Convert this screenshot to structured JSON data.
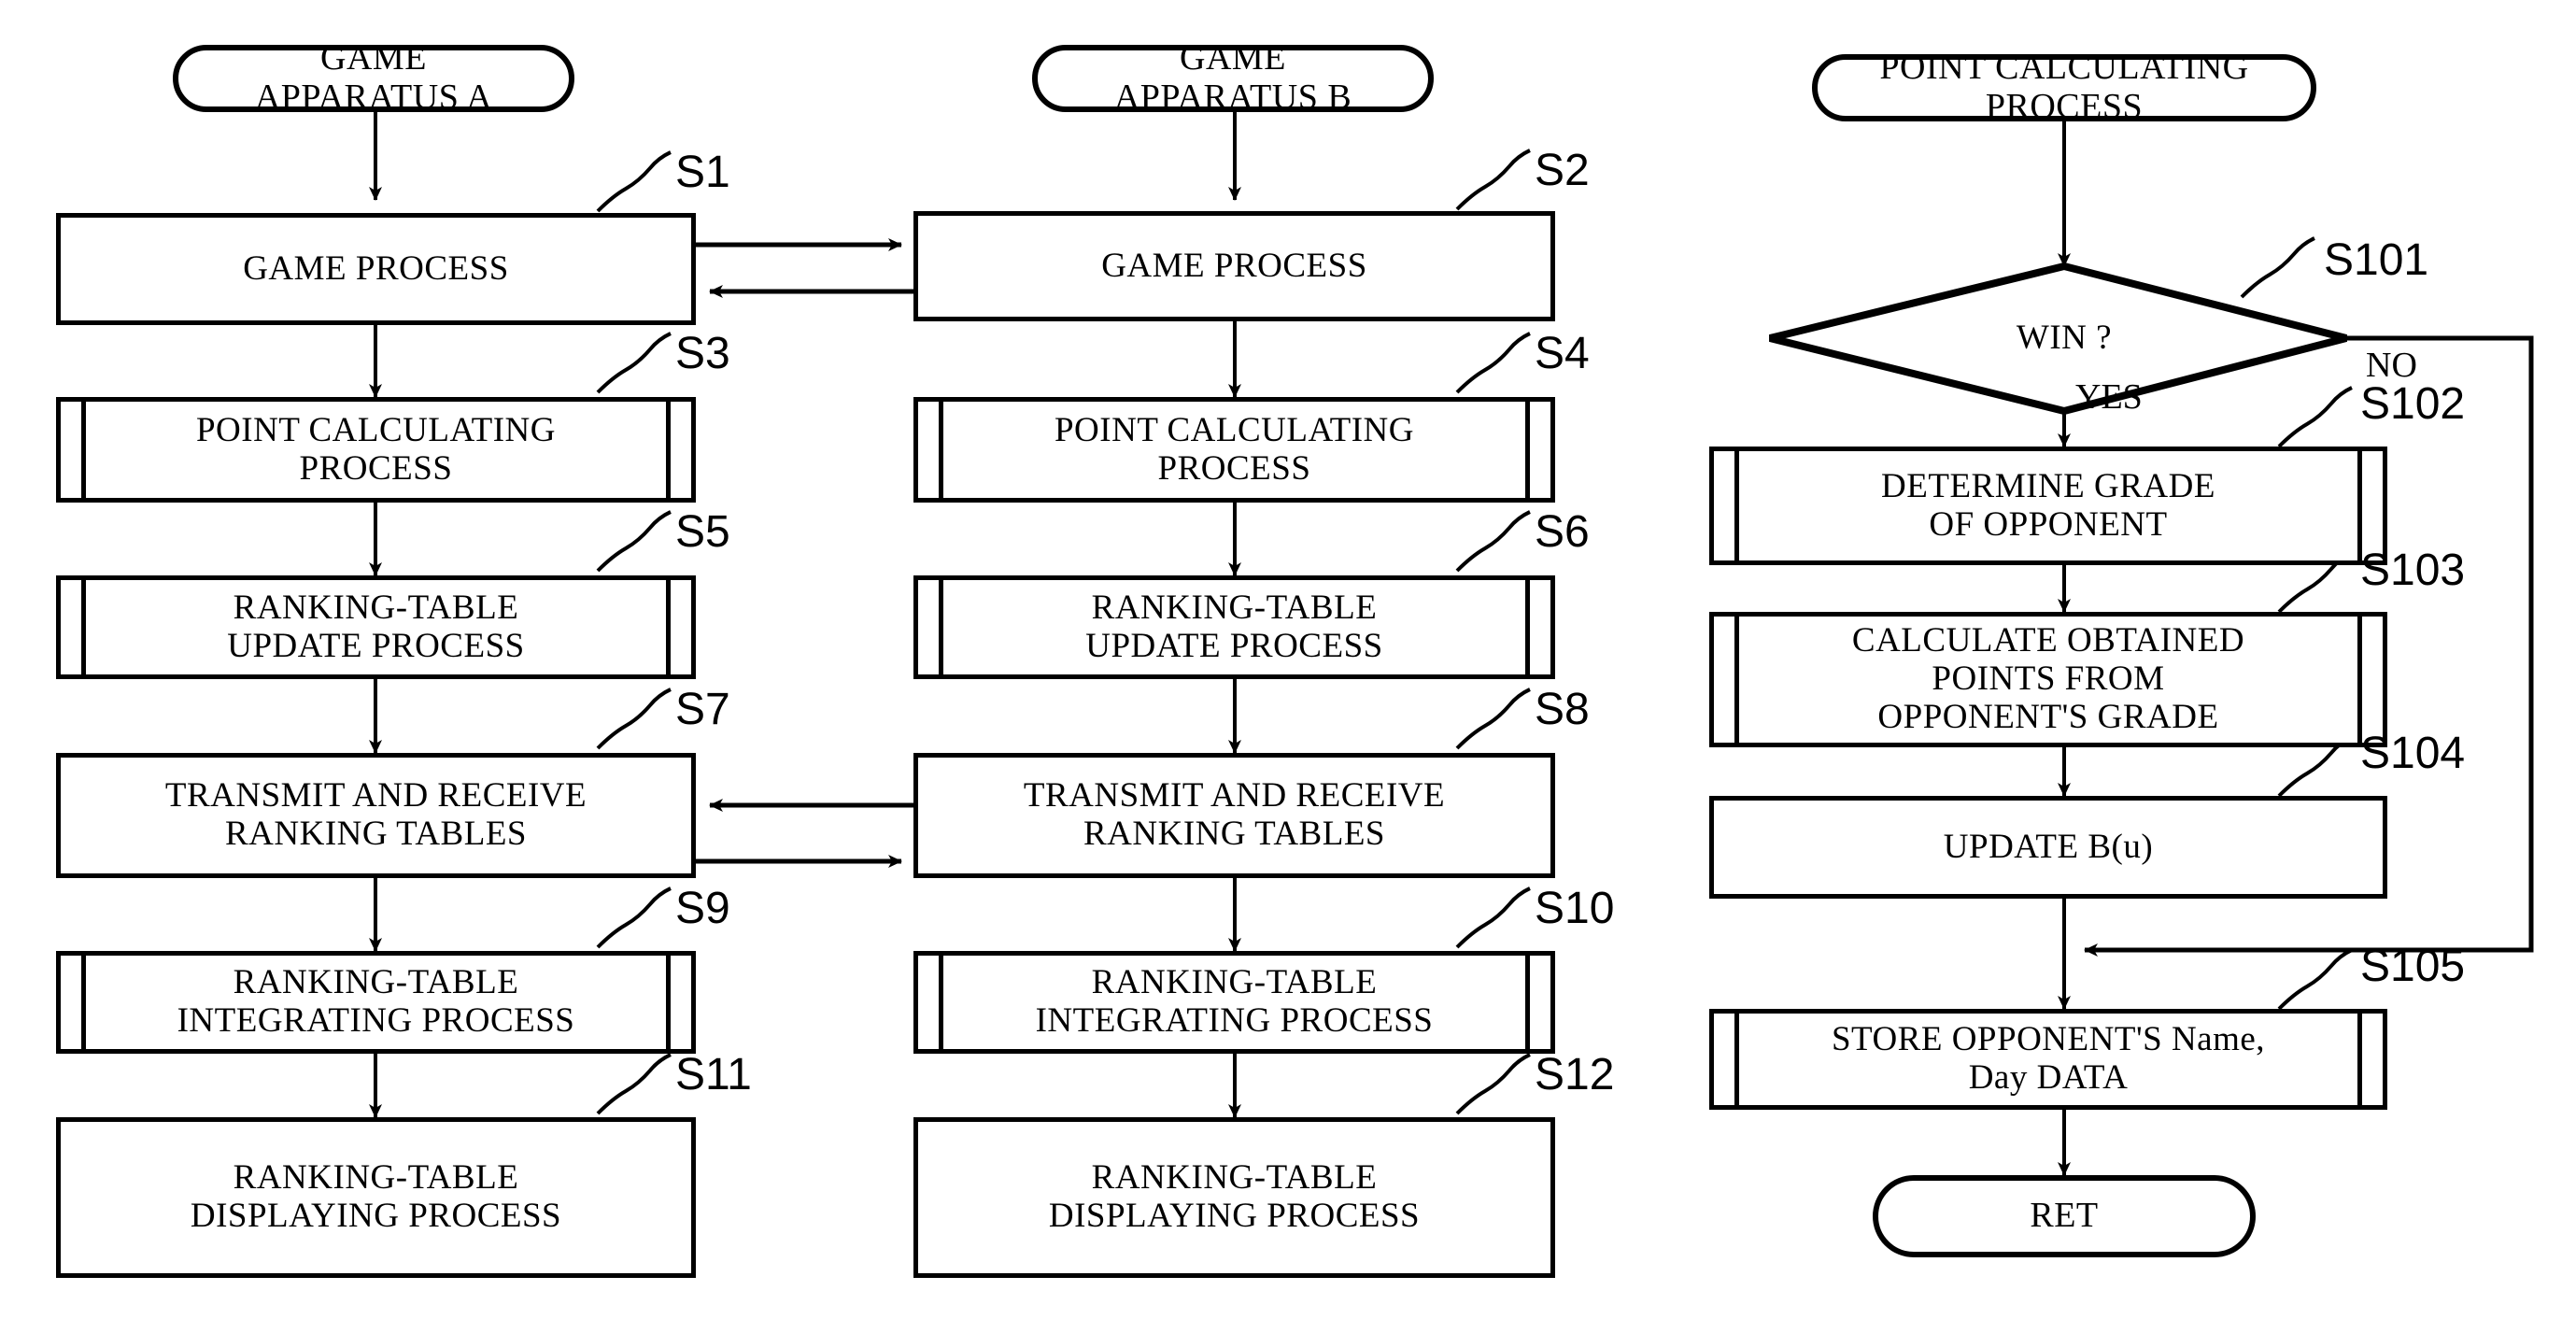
{
  "figure": {
    "type": "flowchart",
    "columns": [
      {
        "id": "apparatus-a",
        "start": "GAME\nAPPARATUS A",
        "steps": [
          {
            "ref": "S1",
            "label": "GAME PROCESS",
            "shape": "process"
          },
          {
            "ref": "S3",
            "label": "POINT CALCULATING\nPROCESS",
            "shape": "predefined-process"
          },
          {
            "ref": "S5",
            "label": "RANKING-TABLE\nUPDATE PROCESS",
            "shape": "predefined-process"
          },
          {
            "ref": "S7",
            "label": "TRANSMIT AND RECEIVE\nRANKING TABLES",
            "shape": "process"
          },
          {
            "ref": "S9",
            "label": "RANKING-TABLE\nINTEGRATING PROCESS",
            "shape": "predefined-process"
          },
          {
            "ref": "S11",
            "label": "RANKING-TABLE\nDISPLAYING PROCESS",
            "shape": "process"
          }
        ]
      },
      {
        "id": "apparatus-b",
        "start": "GAME\nAPPARATUS B",
        "steps": [
          {
            "ref": "S2",
            "label": "GAME PROCESS",
            "shape": "process"
          },
          {
            "ref": "S4",
            "label": "POINT CALCULATING\nPROCESS",
            "shape": "predefined-process"
          },
          {
            "ref": "S6",
            "label": "RANKING-TABLE\nUPDATE PROCESS",
            "shape": "predefined-process"
          },
          {
            "ref": "S8",
            "label": "TRANSMIT AND RECEIVE\nRANKING TABLES",
            "shape": "process"
          },
          {
            "ref": "S10",
            "label": "RANKING-TABLE\nINTEGRATING PROCESS",
            "shape": "predefined-process"
          },
          {
            "ref": "S12",
            "label": "RANKING-TABLE\nDISPLAYING PROCESS",
            "shape": "process"
          }
        ]
      },
      {
        "id": "point-calculating",
        "start": "POINT CALCULATING\nPROCESS",
        "end": "RET",
        "decision": {
          "ref": "S101",
          "label": "WIN ?",
          "yes": "YES",
          "no": "NO"
        },
        "steps": [
          {
            "ref": "S102",
            "label": "DETERMINE GRADE\nOF OPPONENT",
            "shape": "predefined-process"
          },
          {
            "ref": "S103",
            "label": "CALCULATE OBTAINED\nPOINTS FROM\nOPPONENT'S GRADE",
            "shape": "predefined-process"
          },
          {
            "ref": "S104",
            "label": "UPDATE B(u)",
            "shape": "process"
          },
          {
            "ref": "S105",
            "label": "STORE OPPONENT'S Name,\nDay DATA",
            "shape": "predefined-process"
          }
        ]
      }
    ],
    "colors": {
      "stroke": "#000000",
      "background": "#ffffff"
    }
  }
}
